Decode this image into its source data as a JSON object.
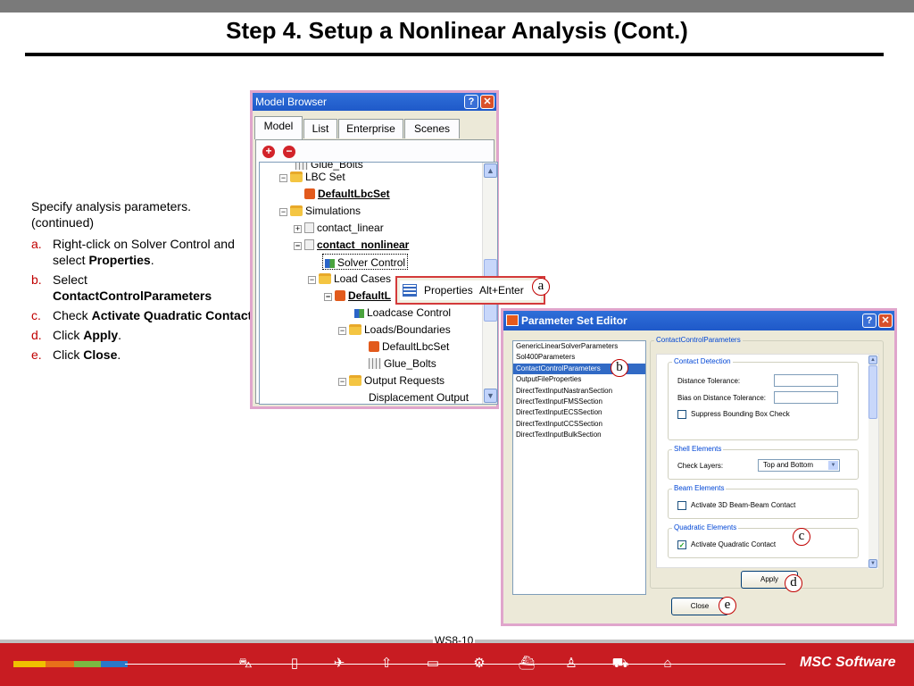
{
  "slide": {
    "title": "Step 4. Setup a Nonlinear Analysis (Cont.)",
    "footer_page": "WS8-10",
    "logo_text": "MSC Software"
  },
  "instructions": {
    "intro": "Specify analysis parameters.",
    "continued": "(continued)",
    "steps": [
      {
        "marker": "a.",
        "text": "Right-click on Solver Control and select ",
        "bold": "Properties",
        "tail": "."
      },
      {
        "marker": "b.",
        "text": "Select ",
        "bold": "ContactControlParameters",
        "tail": ""
      },
      {
        "marker": "c.",
        "text": "Check ",
        "bold": "Activate Quadratic Contact",
        "tail": ""
      },
      {
        "marker": "d.",
        "text": "Click ",
        "bold": "Apply",
        "tail": "."
      },
      {
        "marker": "e.",
        "text": "Click ",
        "bold": "Close",
        "tail": "."
      }
    ]
  },
  "model_browser": {
    "title": "Model Browser",
    "help": "?",
    "close": "✕",
    "tabs": [
      "Model",
      "List",
      "Enterprise",
      "Scenes"
    ],
    "add": "+",
    "remove": "−",
    "tree": [
      "Glue_Bolts",
      "LBC Set",
      "DefaultLbcSet",
      "Simulations",
      "contact_linear",
      "contact_nonlinear",
      "Solver Control",
      "Load Cases",
      "DefaultL",
      "Loadcase Control",
      "Loads/Boundaries",
      "DefaultLbcSet",
      "Glue_Bolts",
      "Output Requests",
      "Displacement Output"
    ]
  },
  "context_menu": {
    "label": "Properties",
    "shortcut": "Alt+Enter"
  },
  "callouts": {
    "a": "a",
    "b": "b",
    "c": "c",
    "d": "d",
    "e": "e"
  },
  "parameter_editor": {
    "title": "Parameter Set Editor",
    "help": "?",
    "close": "✕",
    "list": [
      "GenericLinearSolverParameters",
      "Sol400Parameters",
      "ContactControlParameters",
      "OutputFileProperties",
      "DirectTextInputNastranSection",
      "DirectTextInputFMSSection",
      "DirectTextInputECSSection",
      "DirectTextInputCCSSection",
      "DirectTextInputBulkSection"
    ],
    "group_label": "ContactControlParameters",
    "contact_detection": {
      "label": "Contact Detection",
      "distance_tolerance": "Distance Tolerance:",
      "distance_value": "",
      "bias_tolerance": "Bias on Distance Tolerance:",
      "bias_value": "",
      "suppress": "Suppress Bounding Box Check"
    },
    "shell_elements": {
      "label": "Shell Elements",
      "check_layers": "Check Layers:",
      "check_layers_value": "Top and Bottom"
    },
    "beam_elements": {
      "label": "Beam Elements",
      "activate_3d": "Activate 3D Beam-Beam Contact"
    },
    "quadratic_elements": {
      "label": "Quadratic Elements",
      "activate_quadratic": "Activate Quadratic Contact",
      "checked": "✓"
    },
    "apply": "Apply",
    "close_button": "Close"
  }
}
